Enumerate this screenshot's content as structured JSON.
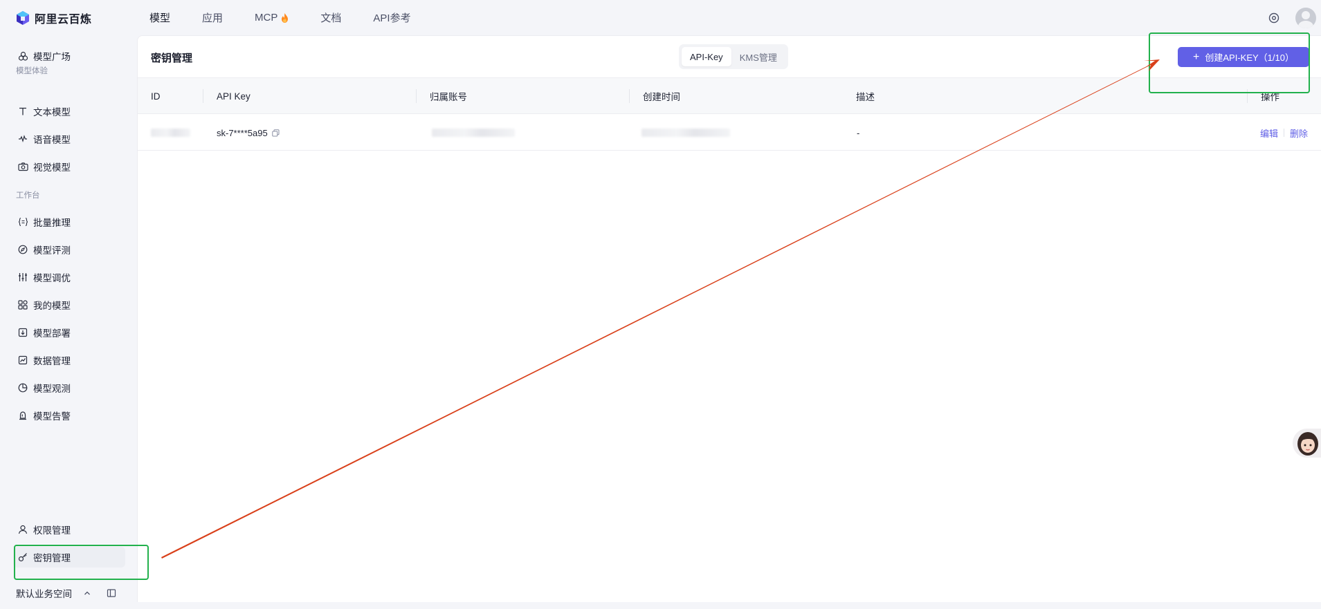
{
  "app": {
    "logo_text": "阿里云百炼"
  },
  "topnav": {
    "items": [
      {
        "label": "模型"
      },
      {
        "label": "应用"
      },
      {
        "label": "MCP"
      },
      {
        "label": "文档"
      },
      {
        "label": "API参考"
      }
    ]
  },
  "sidebar": {
    "model_market": "模型广场",
    "group_experience": "模型体验",
    "text_model": "文本模型",
    "voice_model": "语音模型",
    "vision_model": "视觉模型",
    "group_workbench": "工作台",
    "batch_inference": "批量推理",
    "model_eval": "模型评测",
    "model_tuning": "模型调优",
    "my_models": "我的模型",
    "model_deploy": "模型部署",
    "data_manage": "数据管理",
    "model_observe": "模型观测",
    "model_alert": "模型告警",
    "permission_manage": "权限管理",
    "key_manage": "密钥管理",
    "workspace": "默认业务空间"
  },
  "page": {
    "title": "密钥管理",
    "tabs": [
      "API-Key",
      "KMS管理"
    ],
    "create_button": "创建API-KEY（1/10）"
  },
  "table": {
    "headers": {
      "id": "ID",
      "api_key": "API Key",
      "account": "归属账号",
      "created": "创建时间",
      "description": "描述",
      "actions": "操作"
    },
    "rows": [
      {
        "api_key": "sk-7****5a95",
        "description": "-",
        "edit": "编辑",
        "delete": "删除"
      }
    ]
  },
  "colors": {
    "accent": "#6160e6",
    "annotation_box": "#22b14c",
    "annotation_arrow": "#d9401a"
  }
}
